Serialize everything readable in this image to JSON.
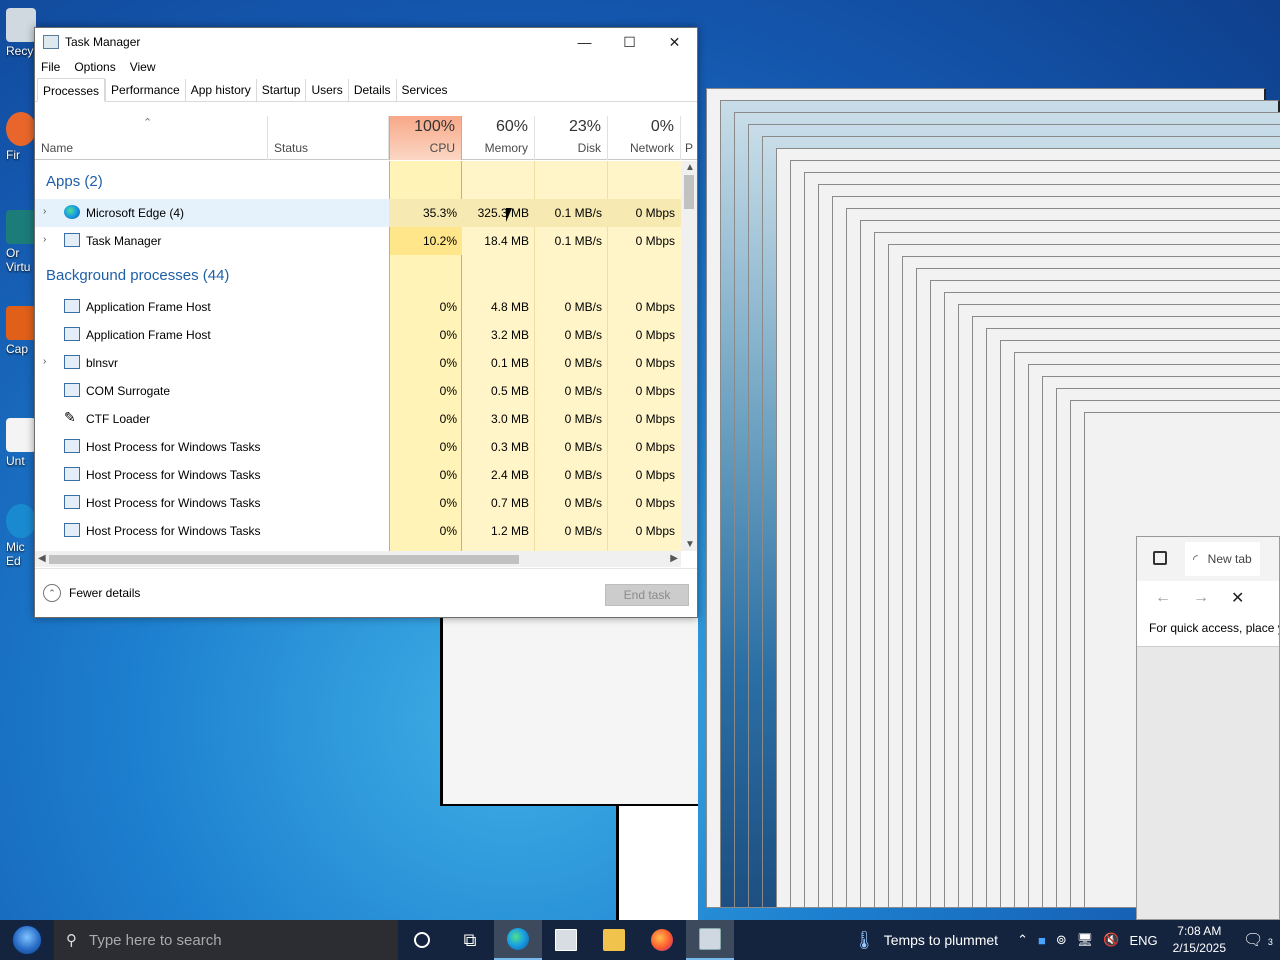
{
  "desktop": {
    "icons": [
      {
        "label": "Recy",
        "color": "#d0d8e0"
      },
      {
        "label": "Fir",
        "color": "#e8662b"
      },
      {
        "label": "Or Virtu",
        "color": "#1b7c7a"
      },
      {
        "label": "Cap",
        "color": "#e0601a"
      },
      {
        "label": "Unt",
        "color": "#f4f4f4"
      },
      {
        "label": "Mic Ed",
        "color": "#1a8ad0"
      }
    ]
  },
  "task_manager": {
    "title": "Task Manager",
    "menu": [
      "File",
      "Options",
      "View"
    ],
    "tabs": [
      "Processes",
      "Performance",
      "App history",
      "Startup",
      "Users",
      "Details",
      "Services"
    ],
    "active_tab": "Processes",
    "columns": {
      "name": "Name",
      "status": "Status",
      "cpu": {
        "pct": "100%",
        "label": "CPU"
      },
      "memory": {
        "pct": "60%",
        "label": "Memory"
      },
      "disk": {
        "pct": "23%",
        "label": "Disk"
      },
      "network": {
        "pct": "0%",
        "label": "Network"
      },
      "power": "P"
    },
    "groups": {
      "apps": "Apps (2)",
      "background": "Background processes (44)"
    },
    "apps": [
      {
        "name": "Microsoft Edge (4)",
        "cpu": "35.3%",
        "memory": "325.3 MB",
        "disk": "0.1 MB/s",
        "network": "0 Mbps",
        "icon": "edge-icon"
      },
      {
        "name": "Task Manager",
        "cpu": "10.2%",
        "memory": "18.4 MB",
        "disk": "0.1 MB/s",
        "network": "0 Mbps",
        "icon": "task-manager-icon"
      }
    ],
    "background": [
      {
        "name": "Application Frame Host",
        "cpu": "0%",
        "memory": "4.8 MB",
        "disk": "0 MB/s",
        "network": "0 Mbps"
      },
      {
        "name": "Application Frame Host",
        "cpu": "0%",
        "memory": "3.2 MB",
        "disk": "0 MB/s",
        "network": "0 Mbps"
      },
      {
        "name": "blnsvr",
        "cpu": "0%",
        "memory": "0.1 MB",
        "disk": "0 MB/s",
        "network": "0 Mbps"
      },
      {
        "name": "COM Surrogate",
        "cpu": "0%",
        "memory": "0.5 MB",
        "disk": "0 MB/s",
        "network": "0 Mbps"
      },
      {
        "name": "CTF Loader",
        "cpu": "0%",
        "memory": "3.0 MB",
        "disk": "0 MB/s",
        "network": "0 Mbps"
      },
      {
        "name": "Host Process for Windows Tasks",
        "cpu": "0%",
        "memory": "0.3 MB",
        "disk": "0 MB/s",
        "network": "0 Mbps"
      },
      {
        "name": "Host Process for Windows Tasks",
        "cpu": "0%",
        "memory": "2.4 MB",
        "disk": "0 MB/s",
        "network": "0 Mbps"
      },
      {
        "name": "Host Process for Windows Tasks",
        "cpu": "0%",
        "memory": "0.7 MB",
        "disk": "0 MB/s",
        "network": "0 Mbps"
      },
      {
        "name": "Host Process for Windows Tasks",
        "cpu": "0%",
        "memory": "1.2 MB",
        "disk": "0 MB/s",
        "network": "0 Mbps"
      }
    ],
    "footer": {
      "fewer_details": "Fewer details",
      "end_task": "End task"
    }
  },
  "edge_window": {
    "tab_label": "New tab",
    "favorites_hint": "For quick access, place y"
  },
  "taskbar": {
    "search_placeholder": "Type here to search",
    "weather": "Temps to plummet",
    "language": "ENG",
    "time": "7:08 AM",
    "date": "2/15/2025",
    "notification_count": "3"
  }
}
